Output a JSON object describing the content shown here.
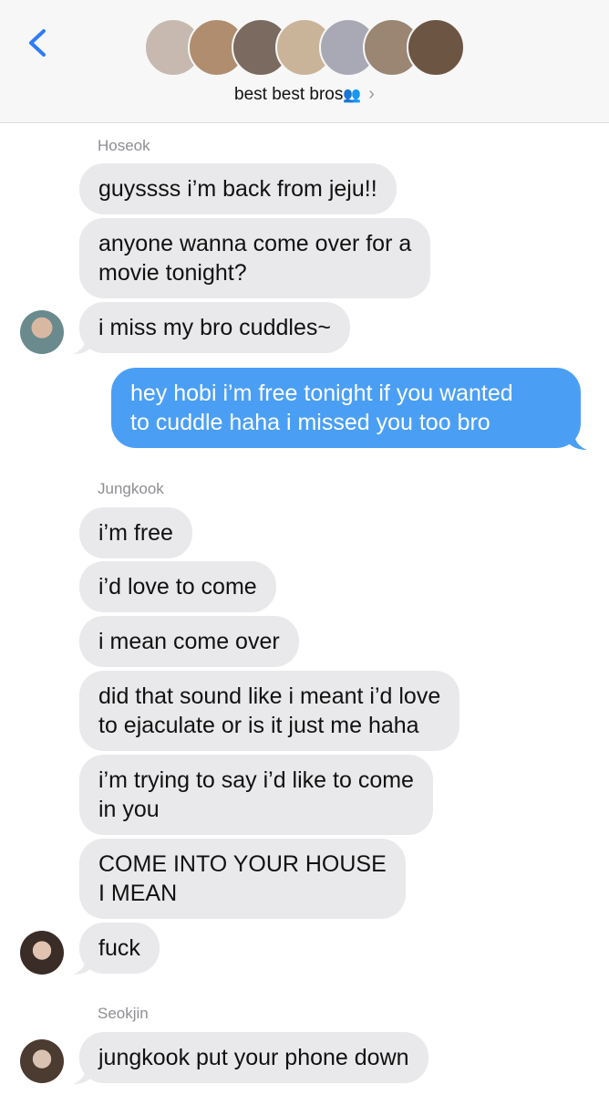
{
  "header": {
    "group_name": "best best bros",
    "group_glyph": "👥",
    "chevron": "›",
    "participants": [
      {
        "color": "#c7b9b0"
      },
      {
        "color": "#b08d6f"
      },
      {
        "color": "#7a6a5f"
      },
      {
        "color": "#c9b49a"
      },
      {
        "color": "#a9a9b5"
      },
      {
        "color": "#9b8573"
      },
      {
        "color": "#6d5544"
      }
    ]
  },
  "messages": {
    "hoseok_name": "Hoseok",
    "m1": "guyssss i’m back from jeju!!",
    "m2": "anyone wanna come over for a\nmovie tonight?",
    "m3": "i miss my bro cuddles~",
    "out1": "hey hobi i’m free tonight if you wanted\nto cuddle haha i missed you too bro",
    "jungkook_name": "Jungkook",
    "m4": "i’m free",
    "m5": "i’d love to come",
    "m6": "i mean come over",
    "m7": "did that sound like i meant i’d love\nto ejaculate or is it just me haha",
    "m8": "i’m trying to say i’d like to come\nin you",
    "m9": "COME INTO YOUR HOUSE\nI MEAN",
    "m10": "fuck",
    "seokjin_name": "Seokjin",
    "m11": "jungkook put your phone down"
  },
  "colors": {
    "incoming": "#e9e9eb",
    "outgoing": "#4a9ff5",
    "accent": "#2f7cf6"
  }
}
